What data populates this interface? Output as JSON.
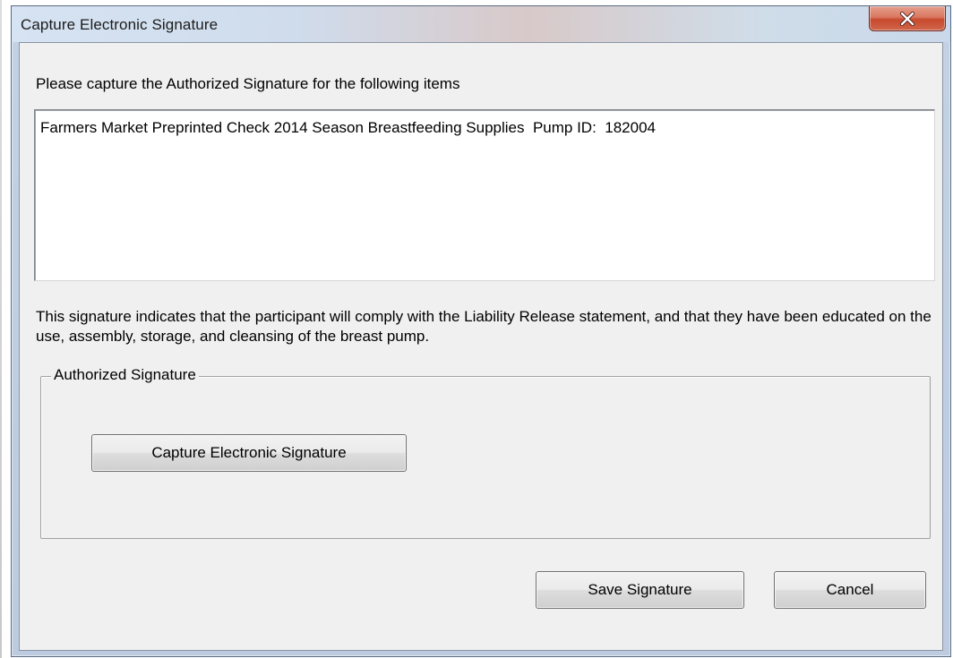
{
  "window": {
    "title": "Capture Electronic Signature",
    "close_icon": "close-x-icon"
  },
  "dialog": {
    "prompt": "Please capture the Authorized Signature for the following items",
    "items_text": "Farmers Market Preprinted Check 2014 Season Breastfeeding Supplies  Pump ID:  182004",
    "statement": "This signature indicates that the participant will comply with the Liability Release statement, and that they have been educated on the use, assembly, storage, and cleansing of the breast pump.",
    "group_label": "Authorized Signature",
    "capture_button_label": "Capture Electronic Signature",
    "save_button_label": "Save Signature",
    "cancel_button_label": "Cancel"
  },
  "colors": {
    "close_button": "#c74a2e",
    "client_background": "#f0f0f0",
    "frame": "#c2d2e4"
  }
}
